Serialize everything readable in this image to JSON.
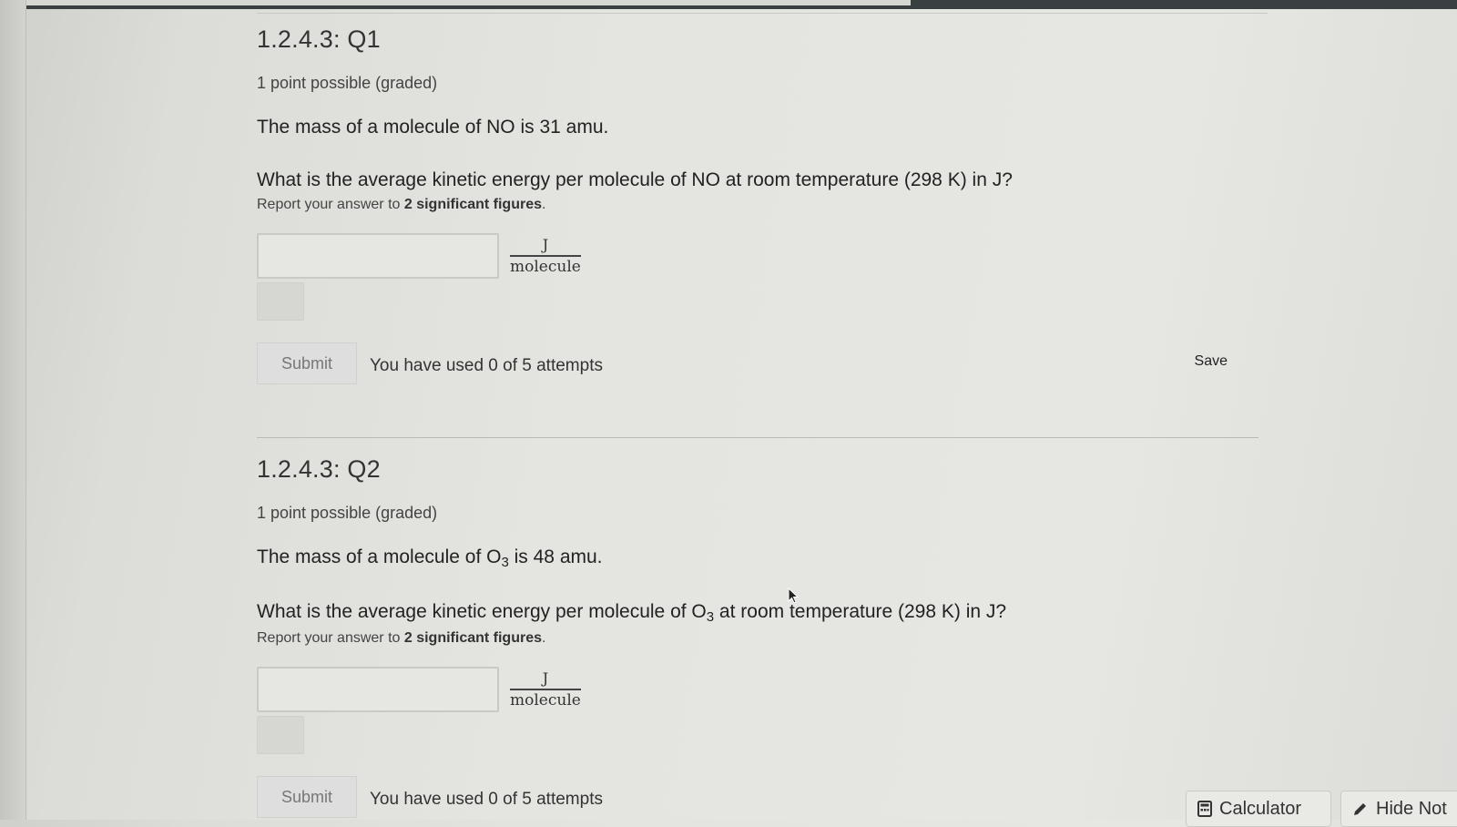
{
  "q1": {
    "title": "1.2.4.3: Q1",
    "points": "1 point possible (graded)",
    "stem": "The mass of a molecule of NO is 31 amu.",
    "question": "What is the average kinetic energy per molecule of NO at room temperature (298 K) in J?",
    "instruction_prefix": "Report your answer to ",
    "instruction_bold": "2 significant figures",
    "instruction_suffix": ".",
    "input_value": "",
    "unit_numerator": "J",
    "unit_denominator": "molecule",
    "submit_label": "Submit",
    "attempts": "You have used 0 of 5 attempts",
    "save_label": "Save"
  },
  "q2": {
    "title": "1.2.4.3: Q2",
    "points": "1 point possible (graded)",
    "stem_prefix": "The mass of a molecule of O",
    "stem_sub": "3",
    "stem_suffix": " is 48 amu.",
    "question_prefix": "What is the average kinetic energy per molecule of O",
    "question_sub": "3",
    "question_suffix": " at room temperature (298 K) in J?",
    "instruction_prefix": "Report your answer to ",
    "instruction_bold": "2 significant figures",
    "instruction_suffix": ".",
    "input_value": "",
    "unit_numerator": "J",
    "unit_denominator": "molecule",
    "submit_label": "Submit",
    "attempts": "You have used 0 of 5 attempts"
  },
  "floating": {
    "calculator_label": "Calculator",
    "calculator_icon": "calculator-icon",
    "notes_label": "Hide Not",
    "notes_icon": "pencil-icon"
  }
}
